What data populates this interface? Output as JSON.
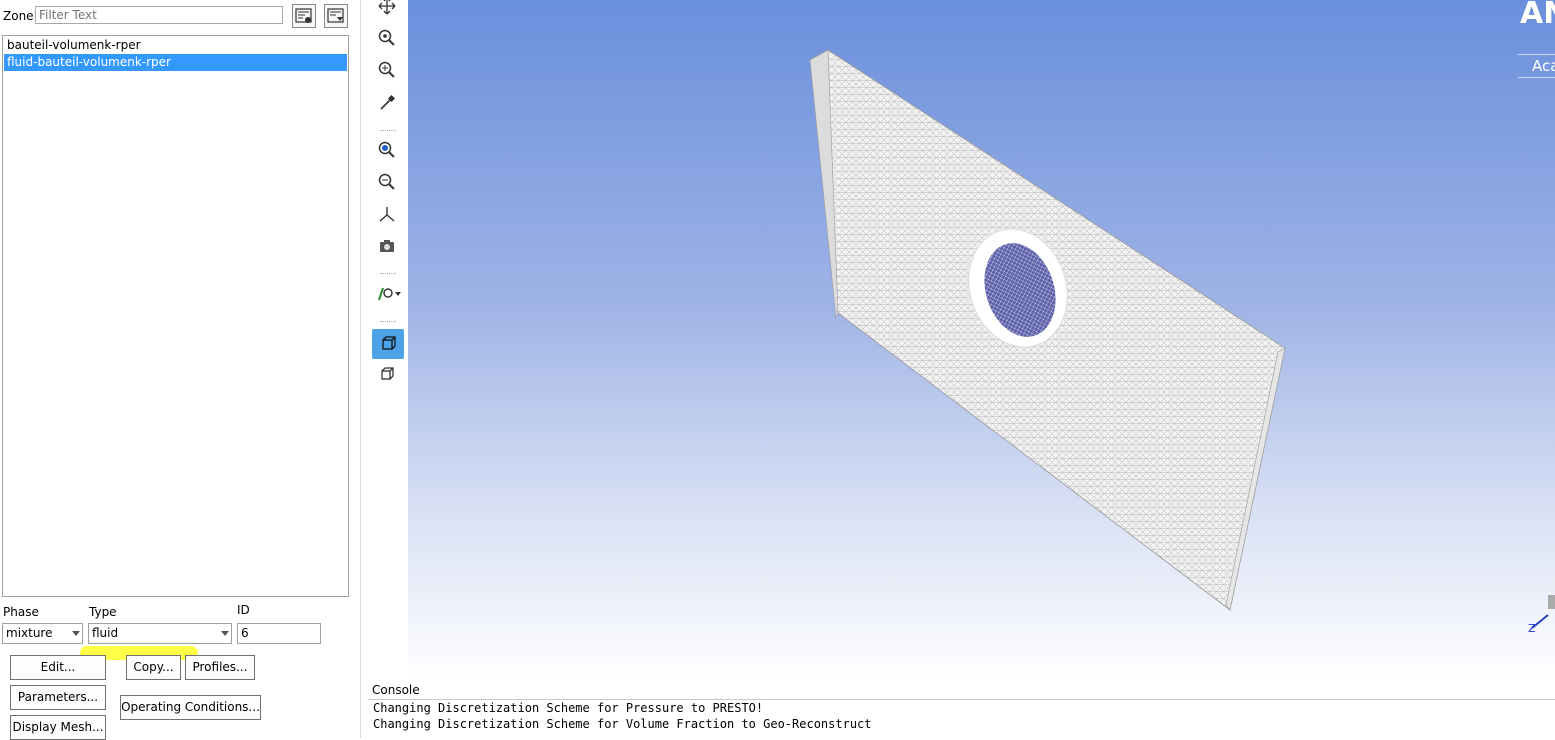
{
  "zone": {
    "label": "Zone",
    "filter_placeholder": "Filter Text",
    "items": [
      {
        "label": "bauteil-volumenk-rper",
        "selected": false
      },
      {
        "label": "fluid-bauteil-volumenk-rper",
        "selected": true
      }
    ]
  },
  "props": {
    "phase_label": "Phase",
    "phase_value": "mixture",
    "type_label": "Type",
    "type_value": "fluid",
    "id_label": "ID",
    "id_value": "6"
  },
  "buttons": {
    "edit": "Edit...",
    "copy": "Copy...",
    "profiles": "Profiles...",
    "parameters": "Parameters...",
    "operating_conditions": "Operating Conditions...",
    "display_mesh": "Display Mesh..."
  },
  "graphics": {
    "brand": "AN",
    "brand_sub": "Aca",
    "colors": {
      "gradient_top": "#6a8fdc",
      "gradient_bottom": "#ffffff",
      "selection": "#3399ff",
      "highlight": "#ffff33"
    }
  },
  "console": {
    "title": "Console",
    "lines": [
      "Changing Discretization Scheme for Pressure to PRESTO!",
      "Changing Discretization Scheme for Volume Fraction to Geo-Reconstruct"
    ]
  },
  "toolbar_icons": [
    "pan-icon",
    "zoom-fit-icon",
    "zoom-in-icon",
    "probe-icon",
    "zoom-to-area-icon",
    "zoom-out-icon",
    "axes-icon",
    "camera-icon",
    "view-options-icon",
    "orthographic-view-icon",
    "perspective-view-icon"
  ]
}
